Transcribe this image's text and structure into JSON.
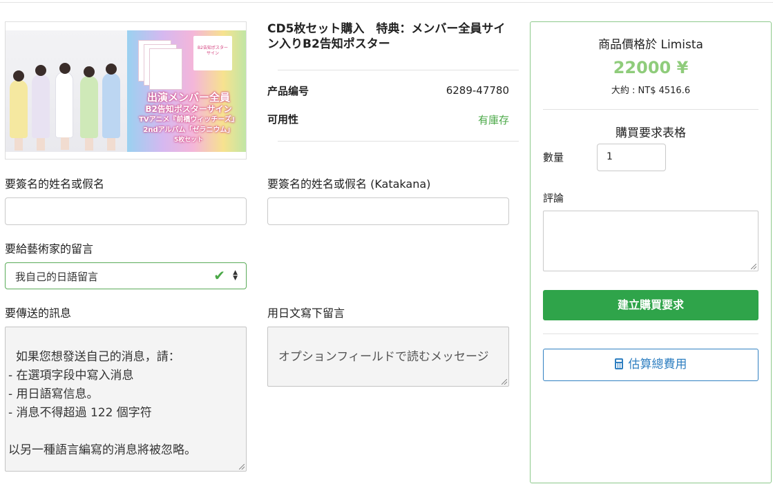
{
  "product": {
    "title": "CD5枚セット購入　特典：メンバー全員サイン入りB2告知ポスター",
    "image": {
      "poster_text": "B2告知ポスター\nサイン",
      "banner_line1": "出演メンバー全員",
      "banner_line2": "B2告知ポスターサイン",
      "banner_line3": "TVアニメ『前橋ウィッチーズ』",
      "banner_line4": "2ndアルバム「ゼラニウム」",
      "banner_line5": "5枚セット"
    },
    "code_label": "产品编号",
    "code_value": "6289-47780",
    "availability_label": "可用性",
    "availability_value": "有庫存",
    "availability_color": "#4aa847"
  },
  "form": {
    "name_label": "要簽名的姓名或假名",
    "name_value": "",
    "name_katakana_label": "要簽名的姓名或假名 (Katakana)",
    "name_katakana_value": "",
    "message_type_label": "要給藝術家的留言",
    "message_type_selected": "我自己的日語留言",
    "message_label": "要傳送的訊息",
    "message_value": "如果您想發送自己的消息，請：\n- 在選項字段中寫入消息\n- 用日語寫信息。\n- 消息不得超過 122 個字符\n\n以另一種語言編寫的消息將被忽略。",
    "japanese_label": "用日文寫下留言",
    "japanese_placeholder": "オプションフィールドで読むメッセージ"
  },
  "panel": {
    "price_title": "商品價格於 Limista",
    "price": "22000 ¥",
    "price_color": "#8fcc7b",
    "approx": "大約 : NT$ 4516.6",
    "form_title": "購買要求表格",
    "qty_label": "數量",
    "qty_value": "1",
    "comment_label": "評論",
    "comment_value": "",
    "submit_label": "建立購買要求",
    "submit_color": "#2fa44a",
    "estimate_label": "估算總費用",
    "estimate_icon": "calculator-icon"
  }
}
